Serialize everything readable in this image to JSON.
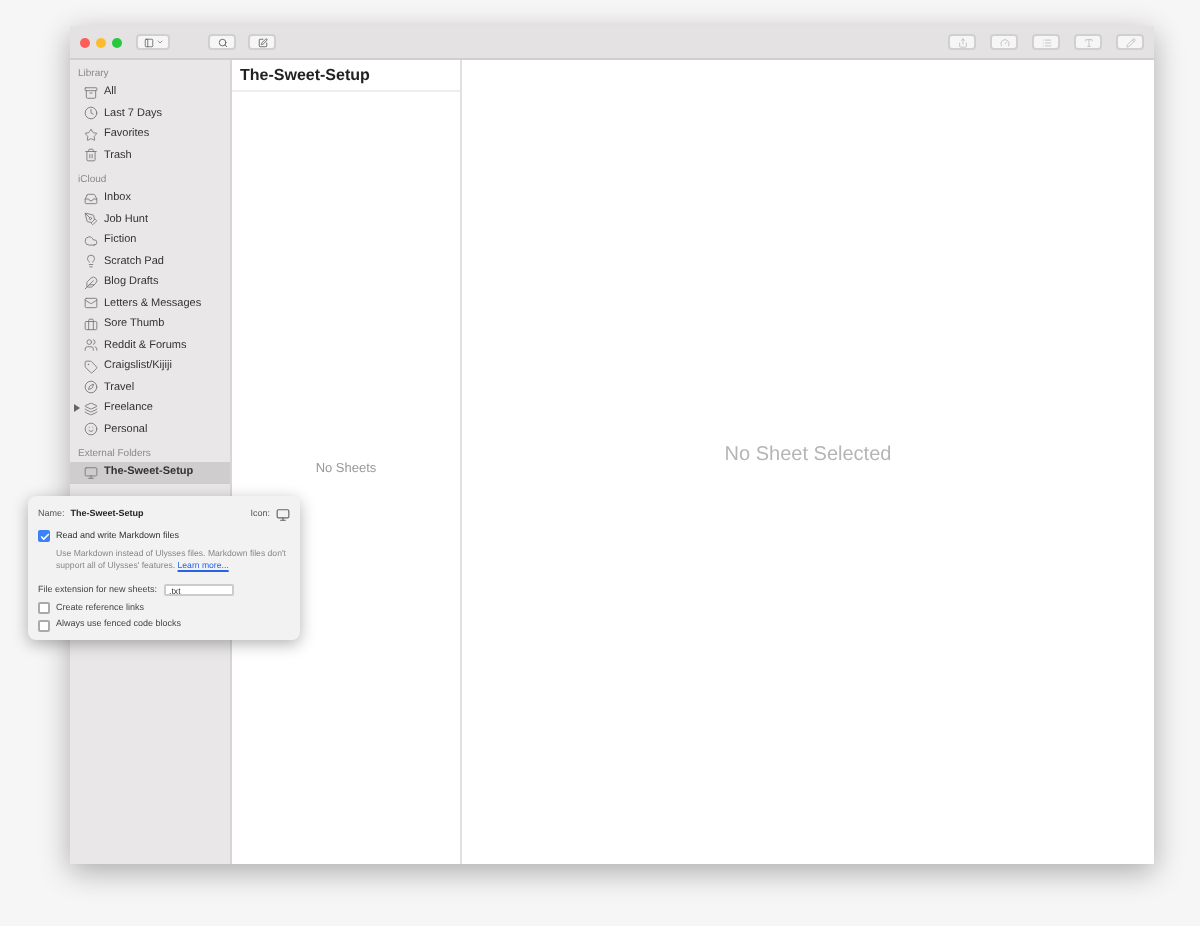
{
  "sidebar": {
    "sections": [
      {
        "title": "Library",
        "items": [
          {
            "label": "All",
            "selected": false
          },
          {
            "label": "Last 7 Days",
            "selected": false
          },
          {
            "label": "Favorites",
            "selected": false
          },
          {
            "label": "Trash",
            "selected": false
          }
        ]
      },
      {
        "title": "iCloud",
        "items": [
          {
            "label": "Inbox",
            "selected": false
          },
          {
            "label": "Job Hunt",
            "selected": false
          },
          {
            "label": "Fiction",
            "selected": false
          },
          {
            "label": "Scratch Pad",
            "selected": false
          },
          {
            "label": "Blog Drafts",
            "selected": false
          },
          {
            "label": "Letters & Messages",
            "selected": false
          },
          {
            "label": "Sore Thumb",
            "selected": false
          },
          {
            "label": "Reddit & Forums",
            "selected": false
          },
          {
            "label": "Craigslist/Kijiji",
            "selected": false
          },
          {
            "label": "Travel",
            "selected": false
          },
          {
            "label": "Freelance",
            "selected": false,
            "expanded": false
          },
          {
            "label": "Personal",
            "selected": false
          }
        ]
      },
      {
        "title": "External Folders",
        "items": [
          {
            "label": "The-Sweet-Setup",
            "selected": true
          }
        ]
      }
    ]
  },
  "sheet_list": {
    "title": "The-Sweet-Setup",
    "empty_text": "No Sheets"
  },
  "editor": {
    "empty_text": "No Sheet Selected"
  },
  "popover": {
    "name_label": "Name:",
    "name_value": "The-Sweet-Setup",
    "icon_label": "Icon:",
    "markdown": {
      "label": "Read and write Markdown files",
      "checked": true
    },
    "description": "Use Markdown instead of Ulysses files. Markdown files don't support all of Ulysses' features.",
    "link": "Learn more...",
    "extension_label": "File extension for new sheets:",
    "extension_value": ".txt",
    "options": [
      {
        "label": "Create reference links",
        "checked": false
      },
      {
        "label": "Always use fenced code blocks",
        "checked": false
      }
    ]
  }
}
